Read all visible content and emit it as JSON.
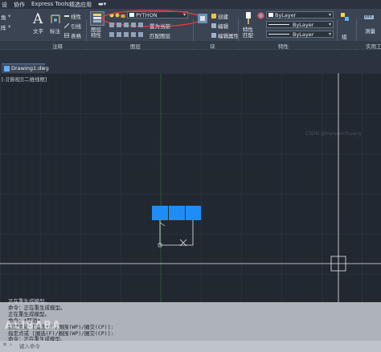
{
  "colors": {
    "accent": "#1e8ef6",
    "highlight_ellipse": "#e23b3b",
    "canvas_bg": "#212830",
    "ribbon_bg": "#3b4453"
  },
  "menubar": {
    "items": [
      "设",
      "协作",
      "Express Tools",
      "精选应用",
      "▬▾"
    ]
  },
  "ribbon": {
    "annotation": {
      "text_label": "文字",
      "mark_label": "标注",
      "table_label": "表格",
      "lead_label": "引线",
      "linear_label": "线性",
      "left_labels": [
        "角",
        "阵"
      ]
    },
    "layers": {
      "properties_label": "图层\n特性",
      "current_layer": "PYTHON",
      "match_layer": "匹配图层",
      "make_current": "置为当前"
    },
    "block": {
      "create": "创建",
      "edit": "编辑",
      "edit_attr": "编辑属性",
      "insert": "插入"
    },
    "properties": {
      "match": "特性\n匹配",
      "color": "ByLayer",
      "linetype": "ByLayer",
      "lineweight": "ByLayer"
    },
    "groups": {
      "group_label": "组"
    },
    "utilities": {
      "measure_label": "测量"
    },
    "panels": {
      "annotation": "注释",
      "layers": "图层",
      "block": "块",
      "properties": "特性",
      "utilities": "实用工"
    }
  },
  "filetab": {
    "name": "Drawing1.dwg"
  },
  "viewport": {
    "label": "[-][俯视][二维线框]"
  },
  "canvas_watermark": "CSDN @meiyanchuang",
  "command": {
    "history": [
      "正在重生成模型。",
      "命令：正在重生成模型。",
      "正在重生成模型。",
      "命令：*取消*",
      "指定点或 [圈选(F)/圈围(WP)/圈交(CP)]:",
      "指定点或 [圈选(F)/圈围(WP)/圈交(CP)]:",
      "命令：正在重生成模型。"
    ],
    "prompt": "键入命令",
    "watermark": "ALIBABA"
  }
}
